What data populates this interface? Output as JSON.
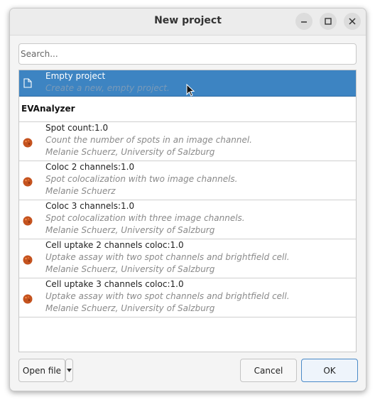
{
  "window": {
    "title": "New project"
  },
  "titlebar_buttons": [
    {
      "icon": "minimize-icon"
    },
    {
      "icon": "maximize-icon"
    },
    {
      "icon": "close-icon"
    }
  ],
  "search": {
    "placeholder": "Search...",
    "value": ""
  },
  "list": {
    "empty_project": {
      "title": "Empty project",
      "description": "Create a new, empty project.",
      "icon": "document-icon"
    },
    "group": {
      "label": "EVAnalyzer"
    },
    "templates": [
      {
        "title": "Spot count:1.0",
        "description": "Count the number of spots in an image channel.",
        "author": "Melanie Schuerz",
        "separator": ", ",
        "affiliation": "University of Salzburg",
        "icon": "cell-icon"
      },
      {
        "title": "Coloc 2 channels:1.0",
        "description": "Spot colocalization with two image channels.",
        "author": "Melanie Schuerz",
        "separator": "",
        "affiliation": "",
        "icon": "cell-icon"
      },
      {
        "title": "Coloc 3 channels:1.0",
        "description": "Spot colocalization with three image channels.",
        "author": "Melanie Schuerz",
        "separator": ", ",
        "affiliation": "University of Salzburg",
        "icon": "cell-icon"
      },
      {
        "title": "Cell uptake 2 channels coloc:1.0",
        "description": "Uptake assay with two spot channels and brightfield cell.",
        "author": "Melanie Schuerz",
        "separator": ", ",
        "affiliation": "University of Salzburg",
        "icon": "cell-icon"
      },
      {
        "title": "Cell uptake 3 channels coloc:1.0",
        "description": "Uptake assay with two spot channels and brightfield cell.",
        "author": "Melanie Schuerz",
        "separator": ", ",
        "affiliation": "University of Salzburg",
        "icon": "cell-icon"
      }
    ]
  },
  "footer": {
    "open_file_label": "Open file",
    "dropdown_icon": "chevron-down-icon",
    "cancel_label": "Cancel",
    "ok_label": "OK"
  },
  "colors": {
    "selection": "#3d84c2",
    "cell_icon": "#c4521e",
    "ok_border": "#4a8ac8"
  }
}
